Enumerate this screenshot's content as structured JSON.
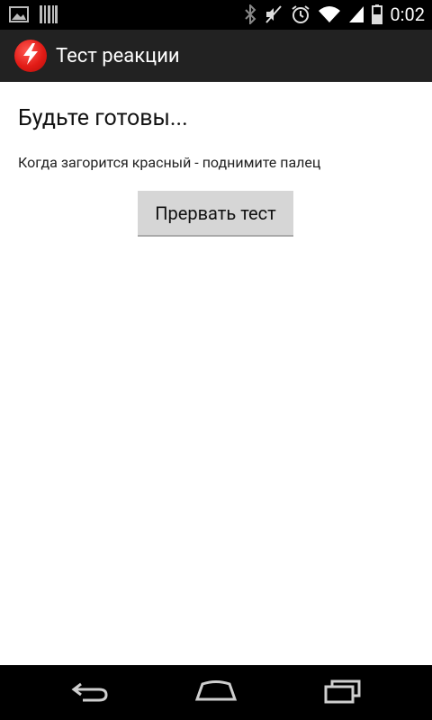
{
  "status_bar": {
    "time": "0:02",
    "icons": [
      "gallery-icon",
      "barcode-icon",
      "bluetooth-icon",
      "mute-icon",
      "alarm-icon",
      "wifi-icon",
      "signal-icon",
      "battery-icon"
    ]
  },
  "action_bar": {
    "title": "Тест реакции",
    "app_icon": "lightning-icon"
  },
  "main": {
    "heading": "Будьте готовы...",
    "instruction": "Когда загорится красный - поднимите палец",
    "abort_label": "Прервать тест"
  },
  "nav_bar": {
    "icons": [
      "back-icon",
      "home-icon",
      "recents-icon"
    ]
  },
  "colors": {
    "app_icon_red": "#e21b16",
    "action_bar_bg": "#222222",
    "button_bg": "#d6d6d6"
  }
}
